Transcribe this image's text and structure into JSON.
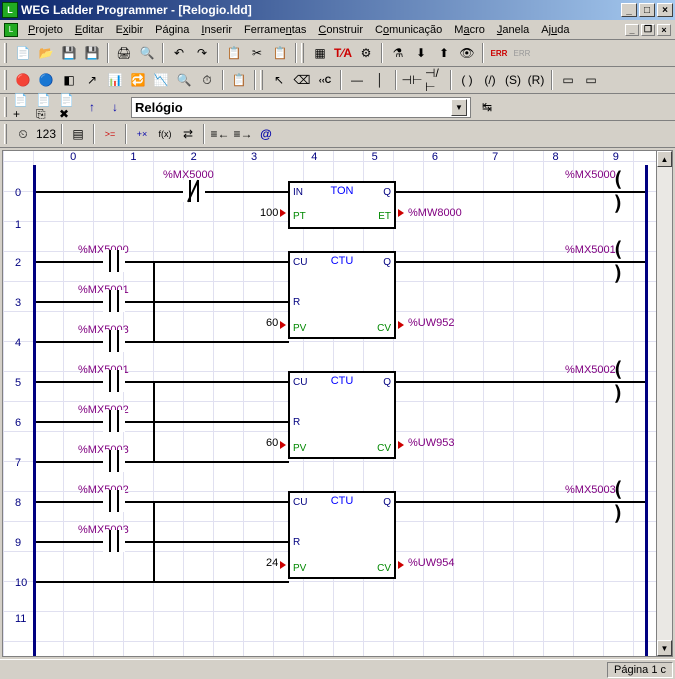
{
  "window": {
    "title": "WEG Ladder Programmer - [Relogio.ldd]"
  },
  "menu": {
    "projeto": "Projeto",
    "editar": "Editar",
    "exibir": "Exibir",
    "pagina": "Página",
    "inserir": "Inserir",
    "ferramentas": "Ferramentas",
    "construir": "Construir",
    "comunicacao": "Comunicação",
    "macro": "Macro",
    "janela": "Janela",
    "ajuda": "Ajuda"
  },
  "pageSelector": {
    "value": "Relógio"
  },
  "columns": [
    "0",
    "1",
    "2",
    "3",
    "4",
    "5",
    "6",
    "7",
    "8",
    "9"
  ],
  "rows": [
    "0",
    "1",
    "2",
    "3",
    "4",
    "5",
    "6",
    "7",
    "8",
    "9",
    "10",
    "11"
  ],
  "labels": {
    "mx5000_1": "%MX5000",
    "mx5000_2": "%MX5000",
    "mx5000_3": "%MX5000",
    "mx5001_1": "%MX5001",
    "mx5001_2": "%MX5001",
    "mx5001_3": "%MX5001",
    "mx5002_1": "%MX5002",
    "mx5002_2": "%MX5002",
    "mx5002_3": "%MX5002",
    "mx5003_1": "%MX5003",
    "mx5003_2": "%MX5003",
    "mx5003_3": "%MX5003",
    "mx5003_4": "%MX5003",
    "mw8000": "%MW8000",
    "uw952": "%UW952",
    "uw953": "%UW953",
    "uw954": "%UW954",
    "p100": "100",
    "p60a": "60",
    "p60b": "60",
    "p24": "24"
  },
  "blocks": {
    "ton": {
      "type": "TON",
      "in": "IN",
      "q": "Q",
      "pt": "PT",
      "et": "ET"
    },
    "ctu1": {
      "type": "CTU",
      "cu": "CU",
      "q": "Q",
      "r": "R",
      "pv": "PV",
      "cv": "CV"
    },
    "ctu2": {
      "type": "CTU",
      "cu": "CU",
      "q": "Q",
      "r": "R",
      "pv": "PV",
      "cv": "CV"
    },
    "ctu3": {
      "type": "CTU",
      "cu": "CU",
      "q": "Q",
      "r": "R",
      "pv": "PV",
      "cv": "CV"
    }
  },
  "status": {
    "page": "Página 1 c"
  }
}
